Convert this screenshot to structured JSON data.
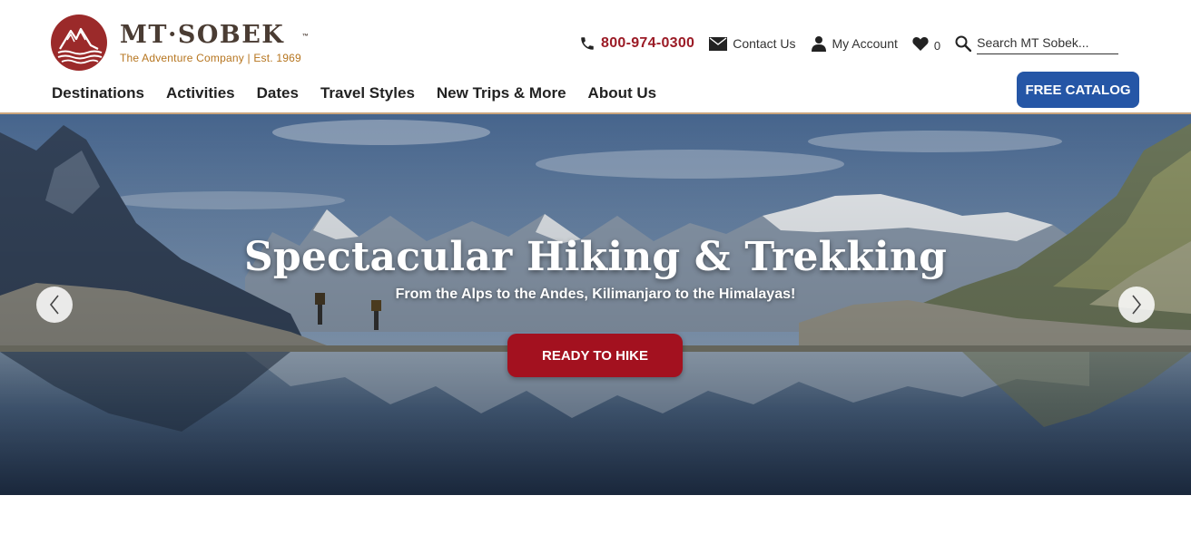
{
  "brand": {
    "name": "MT·SOBEK",
    "trademark": "™",
    "tagline": "The Adventure Company  |  Est. 1969",
    "colors": {
      "logo": "#9b2a2a",
      "brand_text": "#4a3c33",
      "tagline": "#b6751f"
    }
  },
  "utility": {
    "phone": "800-974-0300",
    "contact_label": "Contact Us",
    "account_label": "My Account",
    "favorites_count": "0",
    "search_placeholder": "Search MT Sobek...",
    "icons": [
      "phone-icon",
      "envelope-icon",
      "user-icon",
      "heart-icon",
      "search-icon"
    ]
  },
  "nav": {
    "items": [
      "Destinations",
      "Activities",
      "Dates",
      "Travel Styles",
      "New Trips & More",
      "About Us"
    ],
    "catalog_label": "FREE CATALOG",
    "catalog_color": "#2556a6"
  },
  "hero": {
    "title": "Spectacular Hiking & Trekking",
    "subtitle": "From the Alps to the Andes, Kilimanjaro to the Himalayas!",
    "cta_label": "READY TO HIKE",
    "cta_color": "#a3111f",
    "prev_icon": "chevron-left-icon",
    "next_icon": "chevron-right-icon"
  }
}
